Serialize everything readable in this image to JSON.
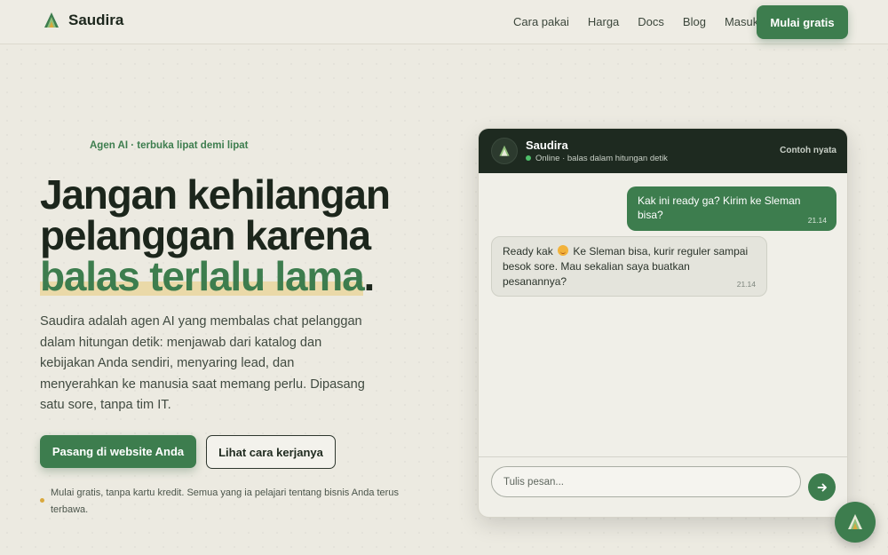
{
  "nav": {
    "brand": "Saudira",
    "logo_icon": "tree-logo-icon",
    "links": [
      "Cara pakai",
      "Harga",
      "Docs",
      "Blog",
      "Masuk"
    ],
    "cta": "Mulai gratis"
  },
  "hero": {
    "eyebrow": "Agen AI · terbuka lipat demi lipat",
    "headline_line1": "Jangan kehilangan",
    "headline_line2": "pelanggan karena",
    "headline_accent": "balas terlalu lama",
    "headline_period": ".",
    "lede": "Saudira adalah agen AI yang membalas chat pelanggan dalam hitungan detik: menjawab dari katalog dan kebijakan Anda sendiri, menyaring lead, dan menyerahkan ke manusia saat memang perlu. Dipasang satu sore, tanpa tim IT.",
    "primary_button": "Pasang di website Anda",
    "secondary_button": "Lihat cara kerjanya",
    "note": "Mulai gratis, tanpa kartu kredit. Semua yang ia pelajari tentang bisnis Anda terus terbawa."
  },
  "chat": {
    "title": "Saudira",
    "status": "Online · balas dalam hitungan detik",
    "tag": "Contoh nyata",
    "messages": [
      {
        "from": "user",
        "text": "Kak ini ready ga? Kirim ke Sleman bisa?",
        "time": "21.14"
      },
      {
        "from": "agent",
        "text_before_emoji": "Ready kak",
        "emoji": "smiling-face-emoji",
        "text_after_emoji": "Ke Sleman bisa, kurir reguler sampai besok sore. Mau sekalian saya buatkan pesanannya?",
        "time": "21.14"
      }
    ],
    "input_placeholder": "Tulis pesan...",
    "send_icon": "arrow-right-icon"
  },
  "floating_button_icon": "tree-logo-icon",
  "colors": {
    "accent": "#3d7d4e",
    "background": "#eceae1",
    "chat_header": "#1e2a20",
    "highlight": "#ead9a8",
    "note_dot": "#d9a83c"
  }
}
